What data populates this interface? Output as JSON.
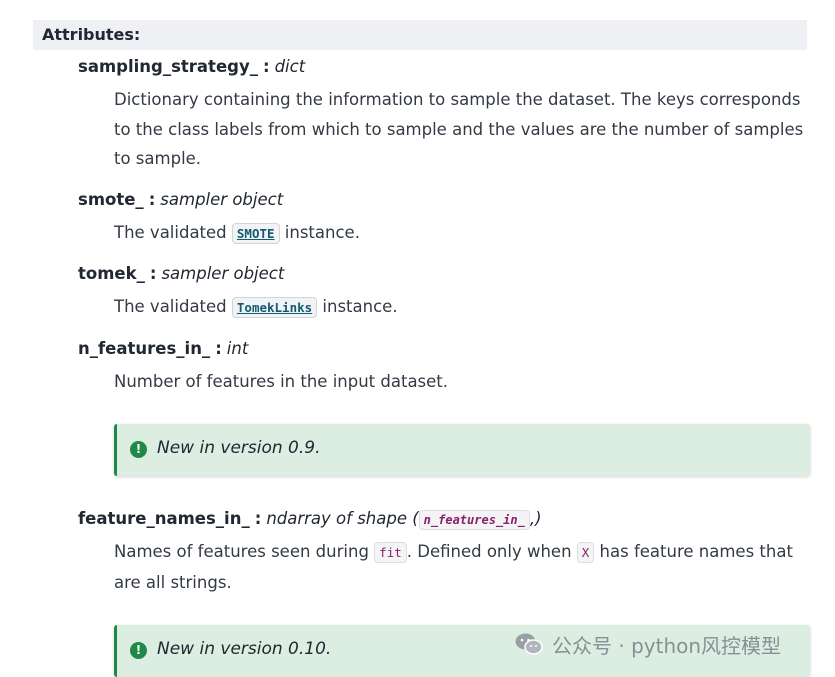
{
  "section": {
    "title": "Attributes:"
  },
  "attributes": [
    {
      "name": "sampling_strategy_",
      "sep": ":",
      "type": "dict",
      "desc": "Dictionary containing the information to sample the dataset. The keys corresponds to the class labels from which to sample and the values are the number of samples to sample."
    },
    {
      "name": "smote_",
      "sep": ":",
      "type": "sampler object",
      "desc_pre": "The validated ",
      "desc_code": "SMOTE",
      "desc_post": " instance."
    },
    {
      "name": "tomek_",
      "sep": ":",
      "type": "sampler object",
      "desc_pre": "The validated ",
      "desc_code": "TomekLinks",
      "desc_post": " instance."
    },
    {
      "name": "n_features_in_",
      "sep": ":",
      "type": "int",
      "desc": "Number of features in the input dataset.",
      "note": "New in version 0.9."
    },
    {
      "name": "feature_names_in_",
      "sep": ":",
      "type_pre": "ndarray of shape (",
      "type_code": "n_features_in_",
      "type_post": ",)",
      "desc_pre": "Names of features seen during ",
      "desc_code1": "fit",
      "desc_mid": ". Defined only when ",
      "desc_code2": "X",
      "desc_post": " has feature names that are all strings.",
      "note": "New in version 0.10."
    }
  ],
  "icons": {
    "note_icon": "exclamation-circle-icon",
    "note_icon_glyph": "!",
    "watermark_icon": "wechat-icon"
  },
  "watermark": {
    "text": "公众号 · python风控模型"
  },
  "colors": {
    "header_bg": "#eef0f3",
    "note_bg": "#dbeee1",
    "note_accent": "#1f8a47",
    "xref_text": "#135a73",
    "literal_text": "#8a1f6a"
  }
}
